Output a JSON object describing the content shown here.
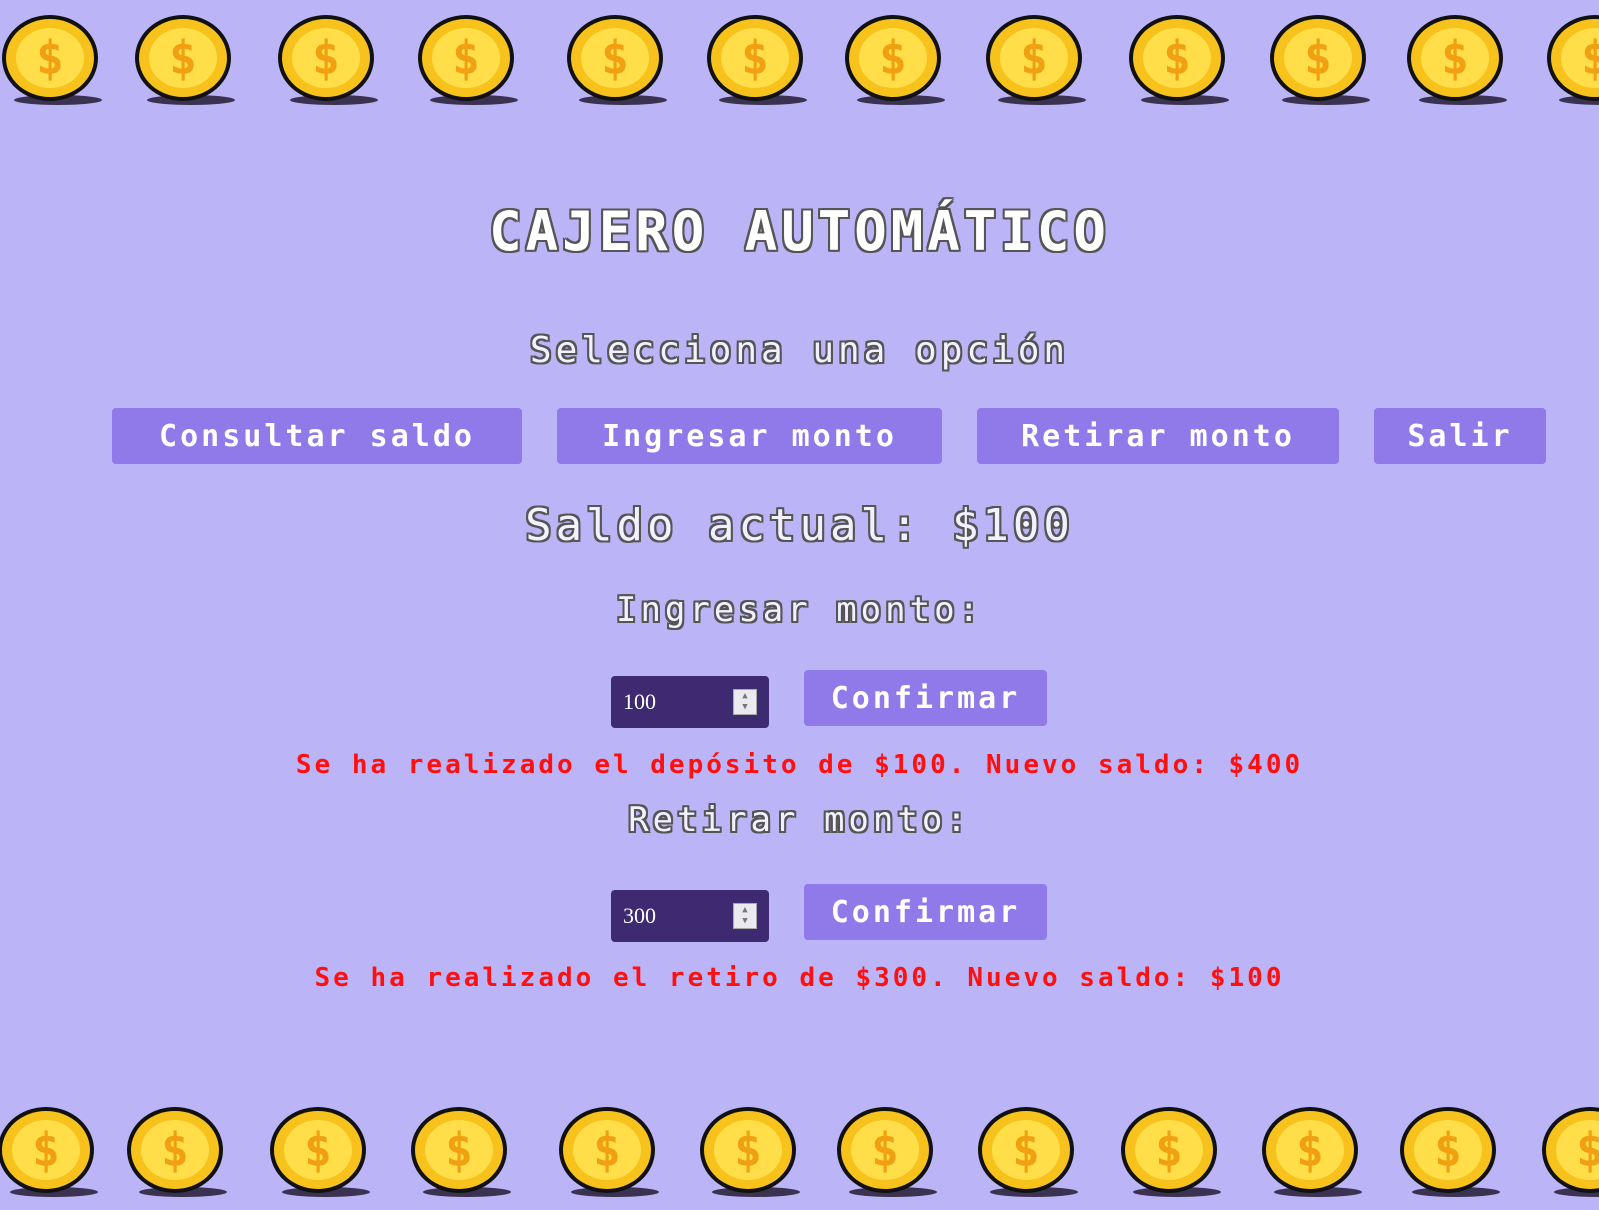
{
  "title": "CAJERO AUTOMÁTICO",
  "subtitle": "Selecciona una opción",
  "menu": {
    "check_balance": "Consultar saldo",
    "deposit": "Ingresar monto",
    "withdraw": "Retirar monto",
    "exit": "Salir"
  },
  "balance_text": "Saldo actual: $100",
  "deposit": {
    "label": "Ingresar monto:",
    "value": "100",
    "confirm": "Confirmar",
    "message": "Se ha realizado el depósito de $100. Nuevo saldo: $400"
  },
  "withdraw": {
    "label": "Retirar monto:",
    "value": "300",
    "confirm": "Confirmar",
    "message": "Se ha realizado el retiro de $300. Nuevo saldo: $100"
  },
  "colors": {
    "background": "#bbb4f6",
    "button": "#9079e8",
    "input_bg": "#3d2a70",
    "message": "#ff1010",
    "coin": "#f7c21c"
  },
  "icons": {
    "coin": "gold-coin-icon"
  }
}
